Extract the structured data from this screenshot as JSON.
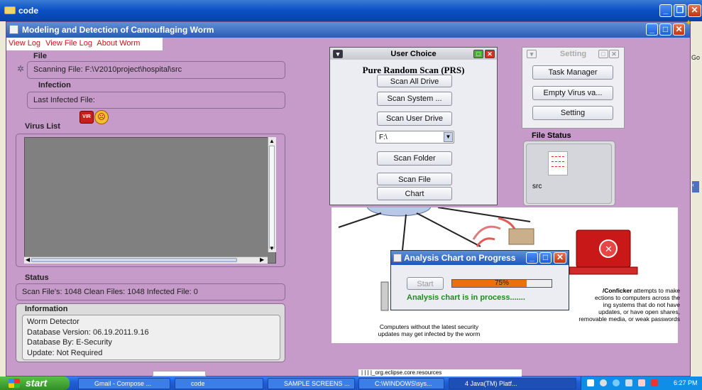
{
  "outer_window": {
    "title": "code"
  },
  "app": {
    "title": "Modeling and Detection of Camouflaging Worm",
    "menu": [
      "View Log",
      "View File Log",
      "About Worm"
    ],
    "file_section": {
      "label": "File",
      "scanning_text": "Scanning File:  F:\\V2010project\\hospital\\src"
    },
    "infection_section": {
      "label": "Infection",
      "text": "Last Infected File:"
    },
    "virus_list": {
      "label": "Virus List"
    },
    "status": {
      "label": "Status",
      "text": "Scan File's: 1048  Clean Files: 1048  Infected File: 0"
    },
    "information": {
      "label": "Information",
      "lines": [
        "Worm Detector",
        "Database Version: 06.19.2011.9.16",
        "Database By: E-Security",
        "Update: Not Required"
      ]
    }
  },
  "user_choice": {
    "title": "User Choice",
    "heading": "Pure Random Scan (PRS)",
    "buttons": {
      "scan_all": "Scan All Drive",
      "scan_system": "Scan System ...",
      "scan_user": "Scan User Drive",
      "scan_folder": "Scan Folder",
      "scan_file": "Scan File",
      "chart": "Chart"
    },
    "drive_value": "F:\\"
  },
  "setting": {
    "title": "Setting",
    "buttons": {
      "task_manager": "Task Manager",
      "empty_virus": "Empty Virus va...",
      "setting": "Setting"
    }
  },
  "file_status": {
    "label": "File Status",
    "file": "src"
  },
  "background_picture": {
    "left_caption": "Computers without the latest security updates may get infected by the worm",
    "right_bold": "/Conficker",
    "right_text_1": " attempts to make",
    "right_lines": [
      "ections to computers across the",
      "ing systems that do not have",
      "updates, or have open shares,",
      "removable media, or weak passwords"
    ]
  },
  "progress_dialog": {
    "title": "Analysis Chart on Progress",
    "start_label": "Start",
    "progress_text": "75%",
    "progress": 0.75,
    "message": "Analysis chart is in process......."
  },
  "eclipse_fragment": "| | | |_org.eclipse.core.resources",
  "right_edge_text": "Go",
  "taskbar": {
    "start": "start",
    "tasks": [
      "Gmail - Compose ...",
      "code",
      "SAMPLE SCREENS ...",
      "C:\\WINDOWS\\sys...",
      "4 Java(TM) Platf..."
    ],
    "clock": "6:27 PM"
  },
  "colors": {
    "app_bg": "#c69bc9",
    "menu_text": "#d0101a",
    "progress_fill": "#e9720d",
    "message_green": "#1f8a1f"
  }
}
